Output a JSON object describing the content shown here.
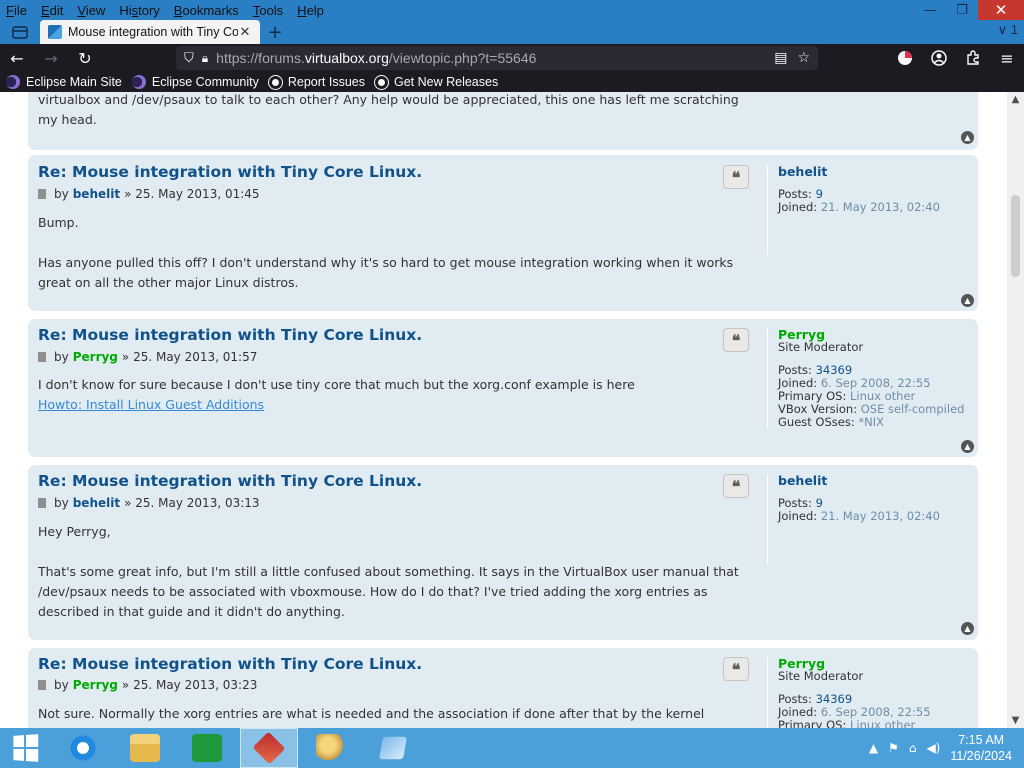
{
  "menu": {
    "items": [
      "File",
      "Edit",
      "View",
      "History",
      "Bookmarks",
      "Tools",
      "Help"
    ],
    "mnemonics": [
      "F",
      "E",
      "V",
      "s",
      "B",
      "T",
      "H"
    ]
  },
  "window_controls": {
    "minimize": "—",
    "restore": "❐",
    "close": "✕"
  },
  "tab": {
    "title": "Mouse integration with Tiny Co",
    "close": "✕",
    "overflow": "∨ 1"
  },
  "nav": {
    "back": "←",
    "forward": "→",
    "reload": "↻",
    "url_prefix": "https://forums.",
    "url_domain": "virtualbox.org",
    "url_path": "/viewtopic.php?t=55646"
  },
  "bookmarks": [
    {
      "label": "Eclipse Main Site",
      "icon": "eclipse-icon"
    },
    {
      "label": "Eclipse Community",
      "icon": "eclipse-icon"
    },
    {
      "label": "Report Issues",
      "icon": "github-icon"
    },
    {
      "label": "Get New Releases",
      "icon": "github-icon"
    }
  ],
  "partial_post": {
    "line1": "virtualbox and /dev/psaux to talk to each other? Any help would be appreciated, this one has left me scratching",
    "line2": "my head."
  },
  "posts": [
    {
      "title": "Re: Mouse integration with Tiny Core Linux.",
      "by": "by",
      "author": "behelit",
      "sep": "»",
      "date": "25. May 2013, 01:45",
      "paragraphs": [
        "Bump.",
        "Has anyone pulled this off? I don't understand why it's so hard to get mouse integration working when it works great on all the other major Linux distros."
      ],
      "profile": {
        "name": "behelit",
        "rank": "",
        "fields": [
          {
            "label": "Posts:",
            "value": "9"
          },
          {
            "label": "Joined:",
            "value": "21. May 2013, 02:40"
          }
        ]
      }
    },
    {
      "title": "Re: Mouse integration with Tiny Core Linux.",
      "by": "by",
      "author": "Perryg",
      "sep": "»",
      "date": "25. May 2013, 01:57",
      "paragraphs": [
        "I don't know for sure because I don't use tiny core that much but the xorg.conf example is here"
      ],
      "link": "Howto: Install Linux Guest Additions",
      "profile": {
        "name": "Perryg",
        "rank": "Site Moderator",
        "fields": [
          {
            "label": "Posts:",
            "value": "34369"
          },
          {
            "label": "Joined:",
            "value": "6. Sep 2008, 22:55"
          },
          {
            "label": "Primary OS:",
            "value": "Linux other"
          },
          {
            "label": "VBox Version:",
            "value": "OSE self-compiled"
          },
          {
            "label": "Guest OSses:",
            "value": "*NIX"
          }
        ]
      }
    },
    {
      "title": "Re: Mouse integration with Tiny Core Linux.",
      "by": "by",
      "author": "behelit",
      "sep": "»",
      "date": "25. May 2013, 03:13",
      "paragraphs": [
        "Hey Perryg,",
        "That's some great info, but I'm still a little confused about something. It says in the VirtualBox user manual that /dev/psaux needs to be associated with vboxmouse. How do I do that? I've tried adding the xorg entries as described in that guide and it didn't do anything."
      ],
      "profile": {
        "name": "behelit",
        "rank": "",
        "fields": [
          {
            "label": "Posts:",
            "value": "9"
          },
          {
            "label": "Joined:",
            "value": "21. May 2013, 02:40"
          }
        ]
      }
    },
    {
      "title": "Re: Mouse integration with Tiny Core Linux.",
      "by": "by",
      "author": "Perryg",
      "sep": "»",
      "date": "25. May 2013, 03:23",
      "paragraphs": [
        "Not sure. Normally the xorg entries are what is needed and the association if done after that by the kernel"
      ],
      "profile": {
        "name": "Perryg",
        "rank": "Site Moderator",
        "fields": [
          {
            "label": "Posts:",
            "value": "34369"
          },
          {
            "label": "Joined:",
            "value": "6. Sep 2008, 22:55"
          },
          {
            "label": "Primary OS:",
            "value": "Linux other"
          }
        ]
      }
    }
  ],
  "quote_glyph": "❝",
  "top_glyph": "▲",
  "taskbar": {
    "time": "7:15 AM",
    "date": "11/26/2024",
    "tray": [
      "▲",
      "⚑",
      "⌂",
      "◀)"
    ]
  },
  "colors": {
    "titlebar": "#2a7fc4",
    "toolbar": "#1c1b22",
    "post_bg": "#e1ebf2",
    "link": "#105289",
    "moderator": "#00aa00",
    "taskbar": "#4ca0da"
  }
}
